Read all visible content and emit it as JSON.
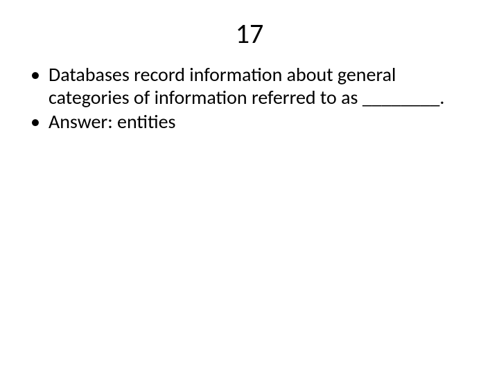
{
  "title": "17",
  "bullets": [
    "Databases record information about general categories of information referred to as ________.",
    "Answer:  entities"
  ]
}
